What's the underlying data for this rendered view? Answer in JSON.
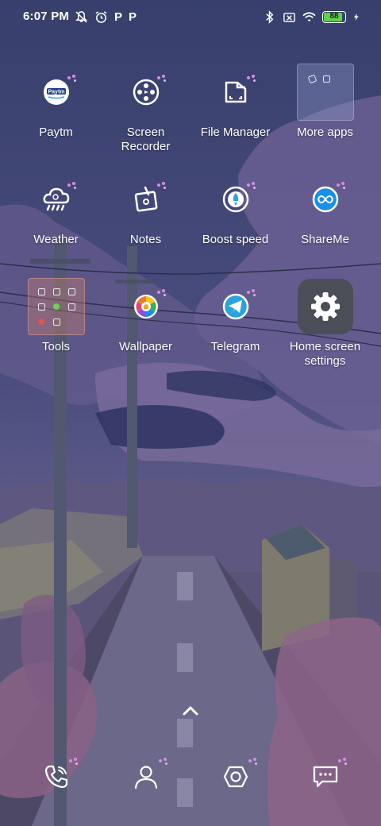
{
  "status_bar": {
    "time": "6:07 PM",
    "left_icons": [
      "notifications-off-icon",
      "alarm-icon",
      "paytm-p-icon",
      "paytm-p-icon"
    ],
    "p_glyph": "P",
    "right_icons": [
      "bluetooth-icon",
      "no-sim-icon",
      "wifi-icon",
      "battery-icon",
      "charging-icon"
    ],
    "battery_level": "88",
    "battery_percent": 88,
    "battery_color": "#5fd04a"
  },
  "apps": [
    {
      "label": "Paytm",
      "icon": "paytm-icon"
    },
    {
      "label": "Screen\nRecorder",
      "icon": "film-reel-icon"
    },
    {
      "label": "File Manager",
      "icon": "folder-icon"
    },
    {
      "label": "More apps",
      "icon": "folder-preview"
    },
    {
      "label": "Weather",
      "icon": "weather-cloud-icon"
    },
    {
      "label": "Notes",
      "icon": "notes-icon"
    },
    {
      "label": "Boost speed",
      "icon": "rocket-icon"
    },
    {
      "label": "ShareMe",
      "icon": "infinity-icon"
    },
    {
      "label": "Tools",
      "icon": "folder-preview"
    },
    {
      "label": "Wallpaper",
      "icon": "color-wheel-icon"
    },
    {
      "label": "Telegram",
      "icon": "paper-plane-icon"
    },
    {
      "label": "Home screen\nsettings",
      "icon": "gear-icon"
    }
  ],
  "paytm_logo_text": "Paytm",
  "dock": [
    {
      "name": "phone",
      "icon": "phone-icon"
    },
    {
      "name": "contacts",
      "icon": "person-icon"
    },
    {
      "name": "camera",
      "icon": "camera-aperture-icon"
    },
    {
      "name": "messages",
      "icon": "chat-bubble-icon"
    }
  ],
  "colors": {
    "sky_top": "#3b4572",
    "sky_bottom": "#5a5a8a",
    "badge_dot": "#d98be6",
    "settings_tile": "#4c4e57",
    "shareme_blue": "#1a8fe6",
    "telegram_blue": "#2aa3e0"
  }
}
